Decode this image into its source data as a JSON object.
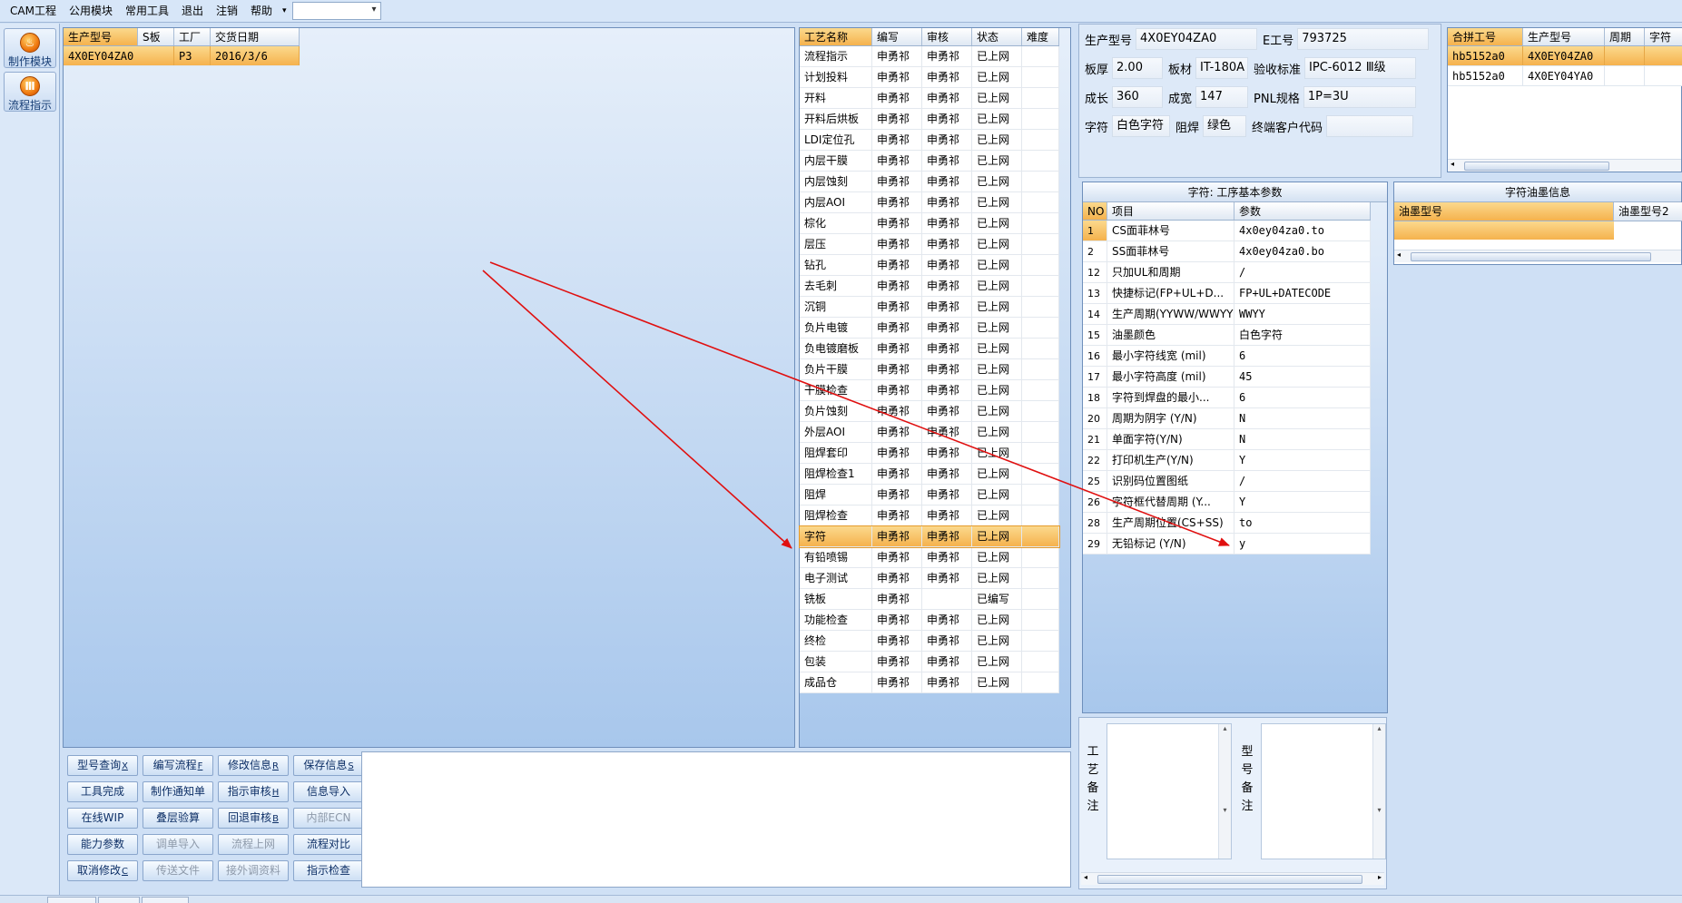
{
  "menu": {
    "items": [
      "CAM工程",
      "公用模块",
      "常用工具",
      "退出",
      "注销",
      "帮助"
    ],
    "combo_value": ""
  },
  "left_toolbar": {
    "buttons": [
      {
        "label": "制作模块",
        "icon": "flame-icon"
      },
      {
        "label": "流程指示",
        "icon": "flow-icon"
      }
    ]
  },
  "job_list": {
    "columns": [
      "生产型号",
      "S板",
      "工厂",
      "交货日期"
    ],
    "rows": [
      {
        "model": "4X0EY04ZA0",
        "s_board": "",
        "factory": "P3",
        "date": "2016/3/6"
      }
    ]
  },
  "process_table": {
    "columns": [
      "工艺名称",
      "编写",
      "审核",
      "状态",
      "难度"
    ],
    "rows": [
      [
        "流程指示",
        "申勇祁",
        "申勇祁",
        "已上网",
        ""
      ],
      [
        "计划投料",
        "申勇祁",
        "申勇祁",
        "已上网",
        ""
      ],
      [
        "开料",
        "申勇祁",
        "申勇祁",
        "已上网",
        ""
      ],
      [
        "开料后烘板",
        "申勇祁",
        "申勇祁",
        "已上网",
        ""
      ],
      [
        "LDI定位孔",
        "申勇祁",
        "申勇祁",
        "已上网",
        ""
      ],
      [
        "内层干膜",
        "申勇祁",
        "申勇祁",
        "已上网",
        ""
      ],
      [
        "内层蚀刻",
        "申勇祁",
        "申勇祁",
        "已上网",
        ""
      ],
      [
        "内层AOI",
        "申勇祁",
        "申勇祁",
        "已上网",
        ""
      ],
      [
        "棕化",
        "申勇祁",
        "申勇祁",
        "已上网",
        ""
      ],
      [
        "层压",
        "申勇祁",
        "申勇祁",
        "已上网",
        ""
      ],
      [
        "钻孔",
        "申勇祁",
        "申勇祁",
        "已上网",
        ""
      ],
      [
        "去毛刺",
        "申勇祁",
        "申勇祁",
        "已上网",
        ""
      ],
      [
        "沉铜",
        "申勇祁",
        "申勇祁",
        "已上网",
        ""
      ],
      [
        "负片电镀",
        "申勇祁",
        "申勇祁",
        "已上网",
        ""
      ],
      [
        "负电镀磨板",
        "申勇祁",
        "申勇祁",
        "已上网",
        ""
      ],
      [
        "负片干膜",
        "申勇祁",
        "申勇祁",
        "已上网",
        ""
      ],
      [
        "干膜检查",
        "申勇祁",
        "申勇祁",
        "已上网",
        ""
      ],
      [
        "负片蚀刻",
        "申勇祁",
        "申勇祁",
        "已上网",
        ""
      ],
      [
        "外层AOI",
        "申勇祁",
        "申勇祁",
        "已上网",
        ""
      ],
      [
        "阻焊套印",
        "申勇祁",
        "申勇祁",
        "已上网",
        ""
      ],
      [
        "阻焊检查1",
        "申勇祁",
        "申勇祁",
        "已上网",
        ""
      ],
      [
        "阻焊",
        "申勇祁",
        "申勇祁",
        "已上网",
        ""
      ],
      [
        "阻焊检查",
        "申勇祁",
        "申勇祁",
        "已上网",
        ""
      ],
      [
        "字符",
        "申勇祁",
        "申勇祁",
        "已上网",
        ""
      ],
      [
        "有铅喷锡",
        "申勇祁",
        "申勇祁",
        "已上网",
        ""
      ],
      [
        "电子测试",
        "申勇祁",
        "申勇祁",
        "已上网",
        ""
      ],
      [
        "铣板",
        "申勇祁",
        "",
        "已编写",
        ""
      ],
      [
        "功能检查",
        "申勇祁",
        "申勇祁",
        "已上网",
        ""
      ],
      [
        "终检",
        "申勇祁",
        "申勇祁",
        "已上网",
        ""
      ],
      [
        "包装",
        "申勇祁",
        "申勇祁",
        "已上网",
        ""
      ],
      [
        "成品仓",
        "申勇祁",
        "申勇祁",
        "已上网",
        ""
      ]
    ],
    "selected_index": 23
  },
  "info": {
    "model_label": "生产型号",
    "model_value": "4X0EY04ZA0",
    "eno_label": "E工号",
    "eno_value": "793725",
    "thickness_label": "板厚",
    "thickness_value": "2.00",
    "material_label": "板材",
    "material_value": "IT-180A",
    "standard_label": "验收标准",
    "standard_value": "IPC-6012 Ⅲ级",
    "length_label": "成长",
    "length_value": "360",
    "width_label": "成宽",
    "width_value": "147",
    "pnl_label": "PNL规格",
    "pnl_value": "1P=3U",
    "char_label": "字符",
    "char_value": "白色字符",
    "mask_label": "阻焊",
    "mask_value": "绿色",
    "customer_label": "终端客户代码",
    "customer_value": ""
  },
  "combine_table": {
    "columns": [
      "合拼工号",
      "生产型号",
      "周期",
      "字符"
    ],
    "rows": [
      [
        "hb5152a0",
        "4X0EY04ZA0",
        "",
        ""
      ],
      [
        "hb5152a0",
        "4X0EY04YA0",
        "",
        ""
      ]
    ]
  },
  "params": {
    "title": "字符: 工序基本参数",
    "columns": [
      "NO",
      "项目",
      "参数"
    ],
    "rows": [
      [
        "1",
        "CS面菲林号",
        "4x0ey04za0.to"
      ],
      [
        "2",
        "SS面菲林号",
        "4x0ey04za0.bo"
      ],
      [
        "12",
        "只加UL和周期",
        "/"
      ],
      [
        "13",
        "快捷标记(FP+UL+D...",
        "FP+UL+DATECODE"
      ],
      [
        "14",
        "生产周期(YYWW/WWYY)",
        "WWYY"
      ],
      [
        "15",
        "油墨颜色",
        "白色字符"
      ],
      [
        "16",
        "最小字符线宽 (mil)",
        "6"
      ],
      [
        "17",
        "最小字符高度 (mil)",
        "45"
      ],
      [
        "18",
        "字符到焊盘的最小...",
        "6"
      ],
      [
        "20",
        "周期为阴字 (Y/N)",
        "N"
      ],
      [
        "21",
        "单面字符(Y/N)",
        "N"
      ],
      [
        "22",
        "打印机生产(Y/N)",
        "Y"
      ],
      [
        "25",
        "识别码位置图纸",
        "/"
      ],
      [
        "26",
        "字符框代替周期 (Y...",
        "Y"
      ],
      [
        "28",
        "生产周期位置(CS+SS)",
        "to"
      ],
      [
        "29",
        "无铅标记 (Y/N)",
        "y"
      ]
    ]
  },
  "ink": {
    "title": "字符油墨信息",
    "columns": [
      "油墨型号",
      "油墨型号2"
    ]
  },
  "notes": {
    "process_note_label": "工艺备注",
    "model_note_label": "型号备注"
  },
  "buttons": [
    {
      "label": "型号查询",
      "key": "X",
      "enabled": true
    },
    {
      "label": "编写流程",
      "key": "F",
      "enabled": true
    },
    {
      "label": "修改信息",
      "key": "R",
      "enabled": true
    },
    {
      "label": "保存信息",
      "key": "S",
      "enabled": true
    },
    {
      "label": "工具完成",
      "key": "",
      "enabled": true
    },
    {
      "label": "制作通知单",
      "key": "",
      "enabled": true
    },
    {
      "label": "指示审核",
      "key": "H",
      "enabled": true
    },
    {
      "label": "信息导入",
      "key": "",
      "enabled": true
    },
    {
      "label": "在线WIP",
      "key": "",
      "enabled": true
    },
    {
      "label": "叠层验算",
      "key": "",
      "enabled": true
    },
    {
      "label": "回退审核",
      "key": "B",
      "enabled": true
    },
    {
      "label": "内部ECN",
      "key": "",
      "enabled": false
    },
    {
      "label": "能力参数",
      "key": "",
      "enabled": true
    },
    {
      "label": "调单导入",
      "key": "",
      "enabled": false
    },
    {
      "label": "流程上网",
      "key": "",
      "enabled": false
    },
    {
      "label": "流程对比",
      "key": "",
      "enabled": true
    },
    {
      "label": "取消修改",
      "key": "C",
      "enabled": true
    },
    {
      "label": "传送文件",
      "key": "",
      "enabled": false
    },
    {
      "label": "接外调资料",
      "key": "",
      "enabled": false
    },
    {
      "label": "指示检查",
      "key": "",
      "enabled": true
    }
  ],
  "colors": {
    "selection": "#f5b24d",
    "arrow": "#e01010",
    "panel_gradient_top": "#e6effa",
    "panel_gradient_bottom": "#a8c7ec"
  }
}
